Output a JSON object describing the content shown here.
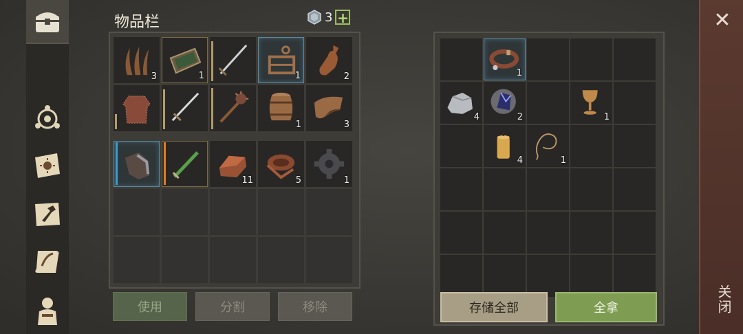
{
  "inventory": {
    "title": "物品栏",
    "gem_count": "3",
    "plus": "+",
    "items": [
      {
        "icon": "seaweed-icon",
        "qty": "3"
      },
      {
        "icon": "frame-icon",
        "qty": "1"
      },
      {
        "icon": "sword-icon",
        "qty": "",
        "bar": "gold"
      },
      {
        "icon": "rack-icon",
        "qty": "1"
      },
      {
        "icon": "bottle-icon",
        "qty": "2"
      },
      {
        "icon": "chainmail-icon",
        "qty": "",
        "bar": "gold"
      },
      {
        "icon": "longsword-icon",
        "qty": "",
        "bar": "gold"
      },
      {
        "icon": "mace-icon",
        "qty": "",
        "bar": "gold"
      },
      {
        "icon": "barrel-icon",
        "qty": "1"
      },
      {
        "icon": "leather-icon",
        "qty": "3"
      },
      {
        "icon": "gauntlet-icon",
        "qty": "",
        "bar": "blue"
      },
      {
        "icon": "dagger-icon",
        "qty": "",
        "bar": "orange"
      },
      {
        "icon": "ingot-icon",
        "qty": "11"
      },
      {
        "icon": "leather-roll-icon",
        "qty": "5"
      },
      {
        "icon": "gear-icon",
        "qty": "1"
      }
    ]
  },
  "container": {
    "items": [
      {
        "icon": "collar-icon",
        "qty": "1"
      },
      {
        "icon": "silver-ore-icon",
        "qty": "4"
      },
      {
        "icon": "crystal-icon",
        "qty": "2"
      },
      {
        "icon": "goblet-icon",
        "qty": "1"
      },
      {
        "icon": "candle-icon",
        "qty": "4"
      },
      {
        "icon": "rope-icon",
        "qty": "1"
      }
    ]
  },
  "buttons": {
    "use": "使用",
    "split": "分割",
    "remove": "移除",
    "store_all": "存储全部",
    "take_all": "全拿"
  },
  "close": {
    "label": "关闭",
    "x": "✕"
  }
}
